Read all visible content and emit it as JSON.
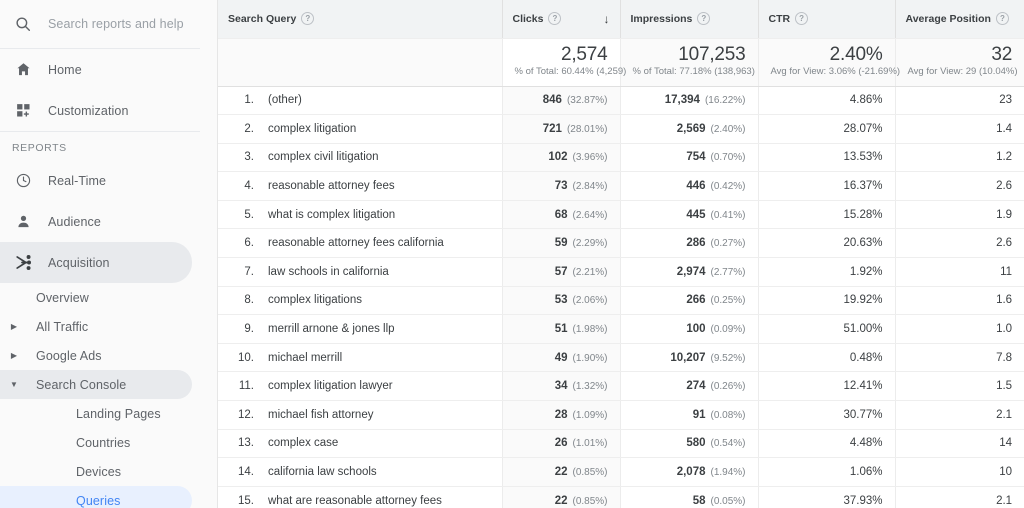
{
  "sidebar": {
    "search": {
      "placeholder": "Search reports and help",
      "icon": "search-icon"
    },
    "top_items": [
      {
        "label": "Home",
        "icon": "home-icon"
      },
      {
        "label": "Customization",
        "icon": "customization-icon"
      }
    ],
    "section_label": "REPORTS",
    "report_items": [
      {
        "label": "Real-Time",
        "icon": "clock-icon",
        "selected": false
      },
      {
        "label": "Audience",
        "icon": "person-icon",
        "selected": false
      },
      {
        "label": "Acquisition",
        "icon": "acquisition-icon",
        "selected": true
      }
    ],
    "acquisition_children": [
      {
        "label": "Overview",
        "caret": "",
        "state": "none"
      },
      {
        "label": "All Traffic",
        "caret": "▶",
        "state": "none"
      },
      {
        "label": "Google Ads",
        "caret": "▶",
        "state": "none"
      },
      {
        "label": "Search Console",
        "caret": "▼",
        "state": "gray"
      }
    ],
    "search_console_children": [
      {
        "label": "Landing Pages",
        "state": "none"
      },
      {
        "label": "Countries",
        "state": "none"
      },
      {
        "label": "Devices",
        "state": "none"
      },
      {
        "label": "Queries",
        "state": "blue"
      }
    ]
  },
  "table": {
    "columns": [
      {
        "label": "Search Query",
        "help": "?",
        "sorted": false
      },
      {
        "label": "Clicks",
        "help": "?",
        "sorted": true,
        "sort_icon": "↓"
      },
      {
        "label": "Impressions",
        "help": "?",
        "sorted": false
      },
      {
        "label": "CTR",
        "help": "?",
        "sorted": false
      },
      {
        "label": "Average Position",
        "help": "?",
        "sorted": false
      }
    ],
    "summary": {
      "clicks_value": "2,574",
      "clicks_note": "% of Total: 60.44% (4,259)",
      "impressions_value": "107,253",
      "impressions_note": "% of Total: 77.18% (138,963)",
      "ctr_value": "2.40%",
      "ctr_note": "Avg for View: 3.06% (-21.69%)",
      "position_value": "32",
      "position_note": "Avg for View: 29 (10.04%)"
    },
    "rows": [
      {
        "index": "1.",
        "query": "(other)",
        "clicks": "846",
        "clicks_pct": "(32.87%)",
        "impressions": "17,394",
        "impressions_pct": "(16.22%)",
        "ctr": "4.86%",
        "position": "23"
      },
      {
        "index": "2.",
        "query": "complex litigation",
        "clicks": "721",
        "clicks_pct": "(28.01%)",
        "impressions": "2,569",
        "impressions_pct": "(2.40%)",
        "ctr": "28.07%",
        "position": "1.4"
      },
      {
        "index": "3.",
        "query": "complex civil litigation",
        "clicks": "102",
        "clicks_pct": "(3.96%)",
        "impressions": "754",
        "impressions_pct": "(0.70%)",
        "ctr": "13.53%",
        "position": "1.2"
      },
      {
        "index": "4.",
        "query": "reasonable attorney fees",
        "clicks": "73",
        "clicks_pct": "(2.84%)",
        "impressions": "446",
        "impressions_pct": "(0.42%)",
        "ctr": "16.37%",
        "position": "2.6"
      },
      {
        "index": "5.",
        "query": "what is complex litigation",
        "clicks": "68",
        "clicks_pct": "(2.64%)",
        "impressions": "445",
        "impressions_pct": "(0.41%)",
        "ctr": "15.28%",
        "position": "1.9"
      },
      {
        "index": "6.",
        "query": "reasonable attorney fees california",
        "clicks": "59",
        "clicks_pct": "(2.29%)",
        "impressions": "286",
        "impressions_pct": "(0.27%)",
        "ctr": "20.63%",
        "position": "2.6"
      },
      {
        "index": "7.",
        "query": "law schools in california",
        "clicks": "57",
        "clicks_pct": "(2.21%)",
        "impressions": "2,974",
        "impressions_pct": "(2.77%)",
        "ctr": "1.92%",
        "position": "11"
      },
      {
        "index": "8.",
        "query": "complex litigations",
        "clicks": "53",
        "clicks_pct": "(2.06%)",
        "impressions": "266",
        "impressions_pct": "(0.25%)",
        "ctr": "19.92%",
        "position": "1.6"
      },
      {
        "index": "9.",
        "query": "merrill arnone & jones llp",
        "clicks": "51",
        "clicks_pct": "(1.98%)",
        "impressions": "100",
        "impressions_pct": "(0.09%)",
        "ctr": "51.00%",
        "position": "1.0"
      },
      {
        "index": "10.",
        "query": "michael merrill",
        "clicks": "49",
        "clicks_pct": "(1.90%)",
        "impressions": "10,207",
        "impressions_pct": "(9.52%)",
        "ctr": "0.48%",
        "position": "7.8"
      },
      {
        "index": "11.",
        "query": "complex litigation lawyer",
        "clicks": "34",
        "clicks_pct": "(1.32%)",
        "impressions": "274",
        "impressions_pct": "(0.26%)",
        "ctr": "12.41%",
        "position": "1.5"
      },
      {
        "index": "12.",
        "query": "michael fish attorney",
        "clicks": "28",
        "clicks_pct": "(1.09%)",
        "impressions": "91",
        "impressions_pct": "(0.08%)",
        "ctr": "30.77%",
        "position": "2.1"
      },
      {
        "index": "13.",
        "query": "complex case",
        "clicks": "26",
        "clicks_pct": "(1.01%)",
        "impressions": "580",
        "impressions_pct": "(0.54%)",
        "ctr": "4.48%",
        "position": "14"
      },
      {
        "index": "14.",
        "query": "california law schools",
        "clicks": "22",
        "clicks_pct": "(0.85%)",
        "impressions": "2,078",
        "impressions_pct": "(1.94%)",
        "ctr": "1.06%",
        "position": "10"
      },
      {
        "index": "15.",
        "query": "what are reasonable attorney fees",
        "clicks": "22",
        "clicks_pct": "(0.85%)",
        "impressions": "58",
        "impressions_pct": "(0.05%)",
        "ctr": "37.93%",
        "position": "2.1"
      }
    ]
  },
  "annotations": {
    "highlight_color": "#ff0000",
    "highlight_target": "Average Position",
    "arrow_target": "32"
  }
}
